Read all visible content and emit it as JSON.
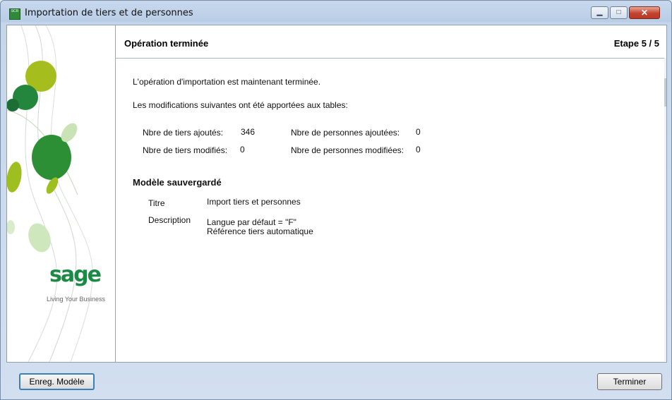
{
  "window": {
    "title": "Importation de tiers et de personnes",
    "app_icon_label": "SCR"
  },
  "header": {
    "title": "Opération terminée",
    "step": "Etape  5 / 5"
  },
  "sidebar": {
    "logo": "sage",
    "tagline": "Living Your Business"
  },
  "content": {
    "line1": "L'opération d'importation est maintenant terminée.",
    "line2": "Les modifications suivantes ont été apportées aux tables:",
    "stats": {
      "tiers_added_label": "Nbre de tiers ajoutés:",
      "tiers_added_value": "346",
      "tiers_modified_label": "Nbre de tiers modifiés:",
      "tiers_modified_value": "0",
      "persons_added_label": "Nbre de personnes ajoutées:",
      "persons_added_value": "0",
      "persons_modified_label": "Nbre de personnes modifiées:",
      "persons_modified_value": "0"
    },
    "model": {
      "section_title": "Modèle sauvergardé",
      "title_label": "Titre",
      "title_value": "Import tiers et personnes",
      "description_label": "Description",
      "description_line1": "Langue par défaut = \"F\"",
      "description_line2": "Référence tiers automatique"
    }
  },
  "footer": {
    "save_model_label": "Enreg. Modèle",
    "finish_label": "Terminer"
  },
  "colors": {
    "accent_green": "#1a8a45",
    "close_red": "#c4422d"
  }
}
